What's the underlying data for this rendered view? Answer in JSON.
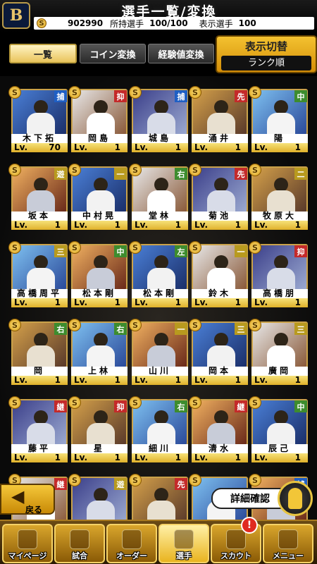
{
  "header": {
    "team_logo": "B",
    "title": "選手一覧/変換",
    "coin_icon": "S",
    "coins": "902990",
    "owned_label": "所持選手",
    "owned_value": "100/100",
    "shown_label": "表示選手",
    "shown_value": "100"
  },
  "tabs": [
    "一覧",
    "コイン変換",
    "経験値変換"
  ],
  "display_switch": {
    "title": "表示切替",
    "value": "ランク順"
  },
  "colors": {
    "pos_catcher": "#1f5fc4",
    "pos_pitcher": "#c42a2a",
    "pos_infield": "#3d8c2e",
    "pos_first": "#b89a1e",
    "frame_gold": "#caa24a"
  },
  "cards": [
    {
      "name": "木下拓",
      "pos": "捕",
      "lv_label": "Lv.",
      "lv": "70"
    },
    {
      "name": "岡島",
      "pos": "抑",
      "lv_label": "Lv.",
      "lv": "1"
    },
    {
      "name": "城島",
      "pos": "捕",
      "lv_label": "Lv.",
      "lv": "1"
    },
    {
      "name": "涌井",
      "pos": "先",
      "lv_label": "Lv.",
      "lv": "1"
    },
    {
      "name": "陽",
      "pos": "中",
      "lv_label": "Lv.",
      "lv": "1"
    },
    {
      "name": "坂本",
      "pos": "遊",
      "lv_label": "Lv.",
      "lv": "1"
    },
    {
      "name": "中村晃",
      "pos": "一",
      "lv_label": "Lv.",
      "lv": "1"
    },
    {
      "name": "堂林",
      "pos": "右",
      "lv_label": "Lv.",
      "lv": "1"
    },
    {
      "name": "菊池",
      "pos": "先",
      "lv_label": "Lv.",
      "lv": "1"
    },
    {
      "name": "牧原大",
      "pos": "二",
      "lv_label": "Lv.",
      "lv": "1"
    },
    {
      "name": "高橋周平",
      "pos": "三",
      "lv_label": "Lv.",
      "lv": "1"
    },
    {
      "name": "松本剛",
      "pos": "中",
      "lv_label": "Lv.",
      "lv": "1"
    },
    {
      "name": "松本剛",
      "pos": "左",
      "lv_label": "Lv.",
      "lv": "1"
    },
    {
      "name": "鈴木",
      "pos": "一",
      "lv_label": "Lv.",
      "lv": "1"
    },
    {
      "name": "高橋朋",
      "pos": "抑",
      "lv_label": "Lv.",
      "lv": "1"
    },
    {
      "name": "岡",
      "pos": "右",
      "lv_label": "Lv.",
      "lv": "1"
    },
    {
      "name": "上林",
      "pos": "右",
      "lv_label": "Lv.",
      "lv": "1"
    },
    {
      "name": "山川",
      "pos": "一",
      "lv_label": "Lv.",
      "lv": "1"
    },
    {
      "name": "岡本",
      "pos": "三",
      "lv_label": "Lv.",
      "lv": "1"
    },
    {
      "name": "廣岡",
      "pos": "三",
      "lv_label": "Lv.",
      "lv": "1"
    },
    {
      "name": "藤平",
      "pos": "継",
      "lv_label": "Lv.",
      "lv": "1"
    },
    {
      "name": "星",
      "pos": "抑",
      "lv_label": "Lv.",
      "lv": "1"
    },
    {
      "name": "細川",
      "pos": "右",
      "lv_label": "Lv.",
      "lv": "1"
    },
    {
      "name": "清水",
      "pos": "継",
      "lv_label": "Lv.",
      "lv": "1"
    },
    {
      "name": "辰己",
      "pos": "中",
      "lv_label": "Lv.",
      "lv": "1"
    },
    {
      "name": "",
      "pos": "継",
      "lv_label": "",
      "lv": ""
    },
    {
      "name": "",
      "pos": "遊",
      "lv_label": "",
      "lv": ""
    },
    {
      "name": "",
      "pos": "先",
      "lv_label": "",
      "lv": ""
    },
    {
      "name": "",
      "pos": "",
      "lv_label": "",
      "lv": ""
    },
    {
      "name": "",
      "pos": "捕",
      "lv_label": "",
      "lv": ""
    }
  ],
  "buttons": {
    "back": "戻る",
    "detail": "詳細確認"
  },
  "nav": {
    "items": [
      "マイページ",
      "試合",
      "オーダー",
      "選手",
      "スカウト",
      "メニュー"
    ],
    "badge": "!"
  }
}
